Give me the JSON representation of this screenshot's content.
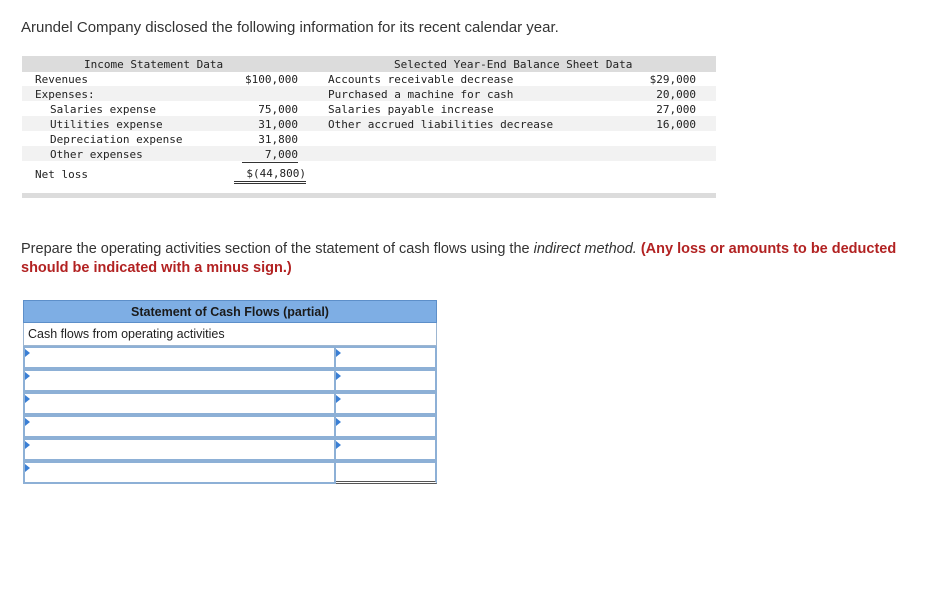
{
  "intro": "Arundel Company disclosed the following information for its recent calendar year.",
  "income_statement": {
    "header": "Income Statement Data",
    "revenues_label": "Revenues",
    "revenues_value": "$100,000",
    "expenses_label": "Expenses:",
    "expenses": [
      {
        "label": "Salaries expense",
        "value": "75,000"
      },
      {
        "label": "Utilities expense",
        "value": "31,000"
      },
      {
        "label": "Depreciation expense",
        "value": "31,800"
      },
      {
        "label": "Other expenses",
        "value": "7,000"
      }
    ],
    "net_loss_label": "Net loss",
    "net_loss_value": "$(44,800)"
  },
  "balance_sheet": {
    "header": "Selected Year-End Balance Sheet Data",
    "items": [
      {
        "label": "Accounts receivable decrease",
        "value": "$29,000"
      },
      {
        "label": "Purchased a machine for cash",
        "value": "20,000"
      },
      {
        "label": "Salaries payable increase",
        "value": "27,000"
      },
      {
        "label": "Other accrued liabilities decrease",
        "value": "16,000"
      }
    ]
  },
  "instructions": {
    "part1": "Prepare the operating activities section of the statement of cash flows using the ",
    "emph": "indirect method.",
    "part2": " ",
    "note": "(Any loss or amounts to be deducted should be indicated with a minus sign.)"
  },
  "cash_flow": {
    "title": "Statement of Cash Flows (partial)",
    "section_label": "Cash flows from operating activities",
    "rows": [
      {
        "label": "",
        "amount": ""
      },
      {
        "label": "",
        "amount": ""
      },
      {
        "label": "",
        "amount": ""
      },
      {
        "label": "",
        "amount": ""
      },
      {
        "label": "",
        "amount": ""
      },
      {
        "label": "",
        "amount": ""
      }
    ]
  }
}
